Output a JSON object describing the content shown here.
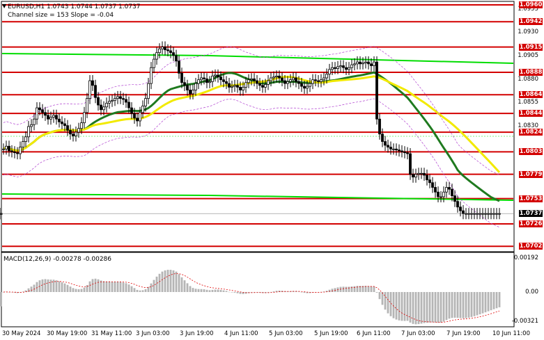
{
  "header": {
    "symbol_line": "EURUSD,H1  1.0743 1.0744 1.0737 1.0737",
    "channel_line": "Channel size = 153 Slope = -0.04"
  },
  "price_axis": {
    "ticks": [
      "1.0955",
      "1.0930",
      "1.0905",
      "1.0880",
      "1.0855",
      "1.0830"
    ]
  },
  "levels": [
    {
      "label": "1.0960",
      "value": 1.096
    },
    {
      "label": "1.0942",
      "value": 1.0942
    },
    {
      "label": "1.0915",
      "value": 1.0915
    },
    {
      "label": "1.0888",
      "value": 1.0888
    },
    {
      "label": "1.0864",
      "value": 1.0864
    },
    {
      "label": "1.0844",
      "value": 1.0844
    },
    {
      "label": "1.0824",
      "value": 1.0824
    },
    {
      "label": "1.0803",
      "value": 1.0803
    },
    {
      "label": "1.0779",
      "value": 1.0779
    },
    {
      "label": "1.0753",
      "value": 1.0753
    },
    {
      "label": "1.0726",
      "value": 1.0726
    },
    {
      "label": "1.0702",
      "value": 1.0702
    }
  ],
  "current_price": {
    "label": "1.0737",
    "value": 1.0737
  },
  "time_axis": [
    "30 May 2024",
    "30 May 19:00",
    "31 May 11:00",
    "3 Jun 03:00",
    "3 Jun 19:00",
    "4 Jun 11:00",
    "5 Jun 03:00",
    "5 Jun 19:00",
    "6 Jun 11:00",
    "7 Jun 03:00",
    "7 Jun 19:00",
    "10 Jun 11:00"
  ],
  "macd": {
    "title": "MACD(12,26,9) -0.00278 -0.00286",
    "ticks": [
      "0.00192",
      "0.00",
      "-0.00321"
    ]
  },
  "colors": {
    "level_line": "#d30000",
    "ma_green": "#1f7a1f",
    "ma_yellow": "#f2ea00",
    "trend_green": "#00dd00",
    "envelope": "#b040d0",
    "macd_hist": "#b5b5b5",
    "macd_signal": "#e00000"
  },
  "chart_data": {
    "type": "line",
    "title": "EURUSD,H1",
    "ylim": [
      1.0697,
      1.0963
    ],
    "series": [
      {
        "name": "EURUSD",
        "x_index": [
          0,
          4,
          8,
          12,
          16,
          20,
          24,
          28,
          32,
          36,
          40,
          44,
          48,
          52,
          56,
          60,
          64,
          68,
          72,
          76,
          80,
          84,
          88,
          92,
          96,
          100,
          104,
          108,
          112,
          116,
          120,
          124,
          128,
          132,
          136,
          140,
          144,
          148,
          152,
          156,
          160,
          164,
          168,
          172,
          176,
          180,
          184,
          188,
          192,
          196,
          200,
          204,
          208,
          212,
          216,
          220,
          224,
          228,
          232,
          236,
          240,
          244,
          248,
          252,
          256,
          260,
          264,
          268,
          272,
          276,
          280,
          284,
          288,
          292,
          296,
          300,
          304,
          308,
          312,
          316,
          320,
          324,
          328,
          332,
          336,
          340,
          344,
          348,
          352,
          356,
          360,
          364,
          368,
          372,
          376,
          380,
          384,
          388,
          392,
          396,
          400,
          404,
          408,
          412,
          416,
          420,
          424,
          428,
          432,
          436,
          440,
          444,
          448,
          452,
          456,
          460,
          464,
          468,
          472,
          476,
          480,
          484,
          488,
          492,
          496,
          500,
          504,
          508,
          512,
          516,
          520,
          524,
          528,
          532,
          536,
          540,
          544,
          548,
          552,
          556,
          560,
          564,
          568,
          572,
          576,
          580,
          584,
          588,
          592,
          596,
          600,
          604,
          608,
          612,
          616,
          620,
          624,
          628,
          632,
          636,
          640,
          644,
          648,
          652,
          656,
          660,
          664,
          668,
          672,
          676,
          680,
          684,
          688,
          692,
          696,
          700,
          704,
          708,
          712
        ],
        "values": [
          1.0806,
          1.0809,
          1.0804,
          1.0803,
          1.0802,
          1.0801,
          1.0808,
          1.0814,
          1.0819,
          1.083,
          1.0832,
          1.0838,
          1.085,
          1.0848,
          1.0845,
          1.0842,
          1.0838,
          1.084,
          1.0842,
          1.0838,
          1.0835,
          1.0833,
          1.0831,
          1.0826,
          1.0822,
          1.082,
          1.0824,
          1.0828,
          1.0834,
          1.0845,
          1.086,
          1.0879,
          1.0874,
          1.0861,
          1.0853,
          1.0848,
          1.0851,
          1.0855,
          1.0857,
          1.0858,
          1.086,
          1.0862,
          1.086,
          1.0859,
          1.0856,
          1.085,
          1.0844,
          1.0839,
          1.0836,
          1.0845,
          1.0852,
          1.086,
          1.0876,
          1.0893,
          1.0902,
          1.0909,
          1.0913,
          1.0915,
          1.0912,
          1.0911,
          1.0909,
          1.0906,
          1.09,
          1.0887,
          1.0877,
          1.0874,
          1.0869,
          1.0865,
          1.0869,
          1.0876,
          1.088,
          1.0882,
          1.0881,
          1.0877,
          1.0878,
          1.0884,
          1.0885,
          1.0883,
          1.088,
          1.0878,
          1.0876,
          1.0872,
          1.0873,
          1.0874,
          1.0872,
          1.0869,
          1.0872,
          1.0877,
          1.088,
          1.0881,
          1.0879,
          1.0876,
          1.0874,
          1.0872,
          1.0875,
          1.0879,
          1.0882,
          1.0883,
          1.0884,
          1.0882,
          1.0879,
          1.0876,
          1.0878,
          1.088,
          1.0882,
          1.0878,
          1.0876,
          1.0873,
          1.0871,
          1.0873,
          1.0876,
          1.088,
          1.0879,
          1.0878,
          1.088,
          1.0882,
          1.0886,
          1.0891,
          1.0893,
          1.0892,
          1.0894,
          1.0895,
          1.0893,
          1.0891,
          1.0893,
          1.0896,
          1.0897,
          1.0899,
          1.0897,
          1.0898,
          1.0899,
          1.0897,
          1.0895,
          1.0899,
          1.0838,
          1.0822,
          1.0814,
          1.081,
          1.0808,
          1.0806,
          1.0806,
          1.0805,
          1.0804,
          1.0803,
          1.0802,
          1.0801,
          1.0779,
          1.0776,
          1.0779,
          1.078,
          1.078,
          1.0778,
          1.0773,
          1.077,
          1.0765,
          1.076,
          1.0755,
          1.0755,
          1.076,
          1.0765,
          1.0763,
          1.0756,
          1.075,
          1.0744,
          1.074,
          1.0737,
          1.0737,
          1.0737,
          1.0737,
          1.0737,
          1.0737,
          1.0737,
          1.0737,
          1.0737,
          1.0737,
          1.0737,
          1.0737,
          1.0737,
          1.0737,
          1.0737,
          1.0737,
          1.0737,
          1.0737,
          1.0737
        ]
      }
    ]
  }
}
